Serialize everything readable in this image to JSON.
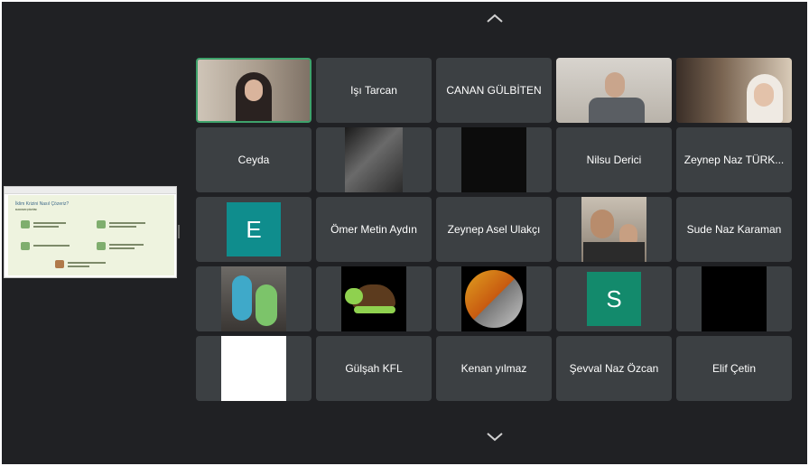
{
  "meeting": {
    "nav_up_icon": "chevron-up-icon",
    "nav_down_icon": "chevron-down-icon"
  },
  "presentation": {
    "slide_title": "İklim Krizini Nasıl Çözeriz?",
    "slide_subtitle": "KARARI ÇÖZÜM"
  },
  "colors": {
    "active_speaker_border": "#3ea26b",
    "tile_background": "#3c4043",
    "avatar_teal": "#0f8d8d",
    "avatar_green": "#138a6c"
  },
  "participants": [
    {
      "label": ""
    },
    {
      "label": "Işı Tarcan"
    },
    {
      "label": "CANAN GÜLBİTEN"
    },
    {
      "label": ""
    },
    {
      "label": ""
    },
    {
      "label": "Ceyda"
    },
    {
      "label": ""
    },
    {
      "label": ""
    },
    {
      "label": "Nilsu Derici"
    },
    {
      "label": "Zeynep Naz TÜRK..."
    },
    {
      "label": "",
      "avatar_letter": "E"
    },
    {
      "label": "Ömer Metin Aydın"
    },
    {
      "label": "Zeynep Asel Ulakçı"
    },
    {
      "label": ""
    },
    {
      "label": "Sude Naz Karaman"
    },
    {
      "label": ""
    },
    {
      "label": ""
    },
    {
      "label": ""
    },
    {
      "label": "",
      "avatar_letter": "S"
    },
    {
      "label": ""
    },
    {
      "label": ""
    },
    {
      "label": "Gülşah KFL"
    },
    {
      "label": "Kenan yılmaz"
    },
    {
      "label": "Şevval Naz Özcan"
    },
    {
      "label": "Elif Çetin"
    }
  ]
}
